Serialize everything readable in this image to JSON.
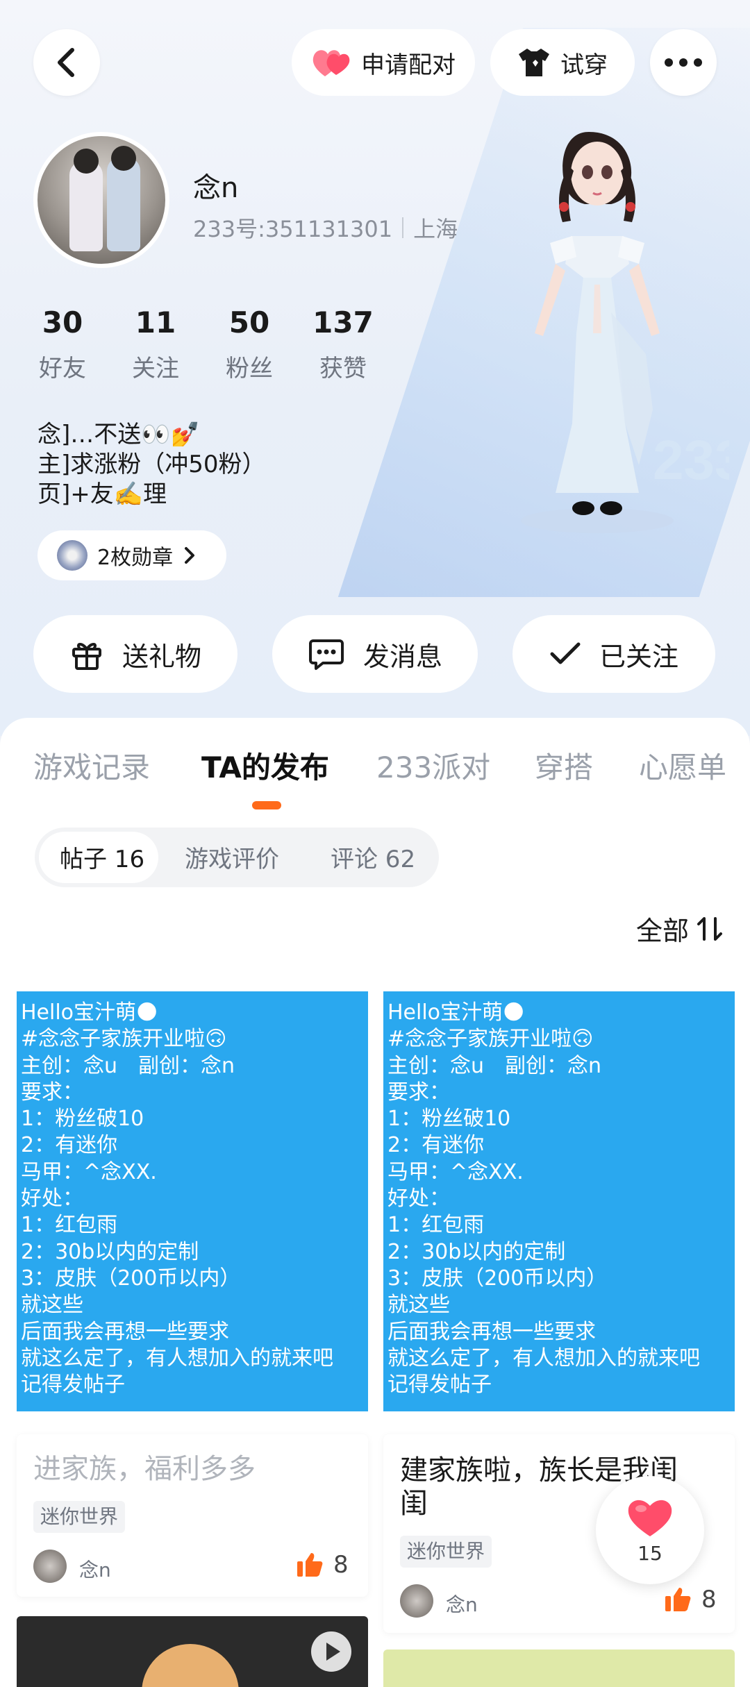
{
  "header": {
    "pair_label": "申请配对",
    "tryon_label": "试穿"
  },
  "profile": {
    "name": "念n",
    "id_text": "233号:351131301",
    "location": "上海",
    "stats": [
      {
        "num": "30",
        "label": "好友"
      },
      {
        "num": "11",
        "label": "关注"
      },
      {
        "num": "50",
        "label": "粉丝"
      },
      {
        "num": "137",
        "label": "获赞"
      }
    ],
    "bio": [
      "念]…不送👀💅",
      "主]求涨粉（冲50粉）",
      "页]+友✍️理"
    ],
    "medal_label": "2枚勋章"
  },
  "actions": {
    "gift": "送礼物",
    "message": "发消息",
    "followed": "已关注"
  },
  "tabs": [
    "游戏记录",
    "TA的发布",
    "233派对",
    "穿搭",
    "心愿单"
  ],
  "subtabs": [
    "帖子 16",
    "游戏评价",
    "评论 62"
  ],
  "sort_label": "全部",
  "cards": [
    {
      "image_lines": [
        "Hello宝汁萌🌑",
        "#念念子家族开业啦🙃",
        "主创：念u　副创：念n",
        "要求：",
        "1：粉丝破10",
        "2：有迷你",
        "马甲：^念XX.",
        "好处：",
        "1：红包雨",
        "2：30b以内的定制",
        "3：皮肤（200币以内）",
        "就这些",
        "后面我会再想一些要求",
        "就这么定了，有人想加入的就来吧",
        "记得发帖子"
      ],
      "title": "进家族，福利多多",
      "tag": "迷你世界",
      "user": "念n",
      "likes": "8"
    },
    {
      "image_lines": [
        "Hello宝汁萌🌑",
        "#念念子家族开业啦🙃",
        "主创：念u　副创：念n",
        "要求：",
        "1：粉丝破10",
        "2：有迷你",
        "马甲：^念XX.",
        "好处：",
        "1：红包雨",
        "2：30b以内的定制",
        "3：皮肤（200币以内）",
        "就这些",
        "后面我会再想一些要求",
        "就这么定了，有人想加入的就来吧",
        "记得发帖子"
      ],
      "title_line1": "建家族啦，族长是我闺",
      "title_line2": "闺",
      "tag": "迷你世界",
      "user": "念n",
      "likes": "8"
    }
  ],
  "float_heart_count": "15",
  "colors": {
    "accent": "#ff6a1a",
    "post_blue": "#2aa8ef",
    "heart": "#ff4d6a"
  }
}
